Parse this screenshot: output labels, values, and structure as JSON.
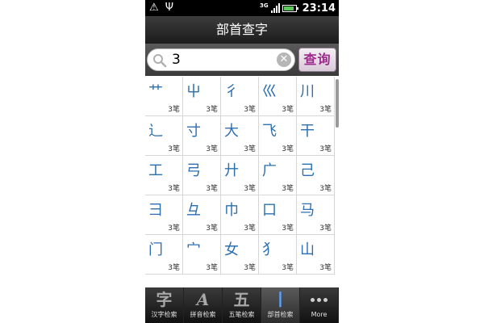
{
  "status_bar": {
    "network": "3G",
    "time": "23:14",
    "battery_level": 0.85,
    "battery_color": "#5cc75c"
  },
  "title": "部首查字",
  "search": {
    "value": "3",
    "clear_icon": "clear-icon",
    "query_label": "查询"
  },
  "grid": [
    {
      "radical": "艹",
      "strokes": "3笔"
    },
    {
      "radical": "屮",
      "strokes": "3笔"
    },
    {
      "radical": "彳",
      "strokes": "3笔"
    },
    {
      "radical": "巛",
      "strokes": "3笔"
    },
    {
      "radical": "川",
      "strokes": "3笔"
    },
    {
      "radical": "辶",
      "strokes": "3笔"
    },
    {
      "radical": "寸",
      "strokes": "3笔"
    },
    {
      "radical": "大",
      "strokes": "3笔"
    },
    {
      "radical": "飞",
      "strokes": "3笔"
    },
    {
      "radical": "干",
      "strokes": "3笔"
    },
    {
      "radical": "工",
      "strokes": "3笔"
    },
    {
      "radical": "弓",
      "strokes": "3笔"
    },
    {
      "radical": "廾",
      "strokes": "3笔"
    },
    {
      "radical": "广",
      "strokes": "3笔"
    },
    {
      "radical": "己",
      "strokes": "3笔"
    },
    {
      "radical": "彐",
      "strokes": "3笔"
    },
    {
      "radical": "彑",
      "strokes": "3笔"
    },
    {
      "radical": "巾",
      "strokes": "3笔"
    },
    {
      "radical": "口",
      "strokes": "3笔"
    },
    {
      "radical": "马",
      "strokes": "3笔"
    },
    {
      "radical": "门",
      "strokes": "3笔"
    },
    {
      "radical": "宀",
      "strokes": "3笔"
    },
    {
      "radical": "女",
      "strokes": "3笔"
    },
    {
      "radical": "犭",
      "strokes": "3笔"
    },
    {
      "radical": "山",
      "strokes": "3笔"
    }
  ],
  "tabs": [
    {
      "glyph": "字",
      "label": "汉字检索",
      "active": false
    },
    {
      "glyph": "A",
      "label": "拼音检索",
      "active": false
    },
    {
      "glyph": "五",
      "label": "五笔检索",
      "active": false
    },
    {
      "glyph": "丨",
      "label": "部首检索",
      "active": true
    },
    {
      "glyph": "",
      "label": "More",
      "active": false
    }
  ],
  "colors": {
    "radical_text": "#2d6fb0",
    "accent_tab": "#5aa0ff",
    "query_text": "#9c2a8a"
  }
}
